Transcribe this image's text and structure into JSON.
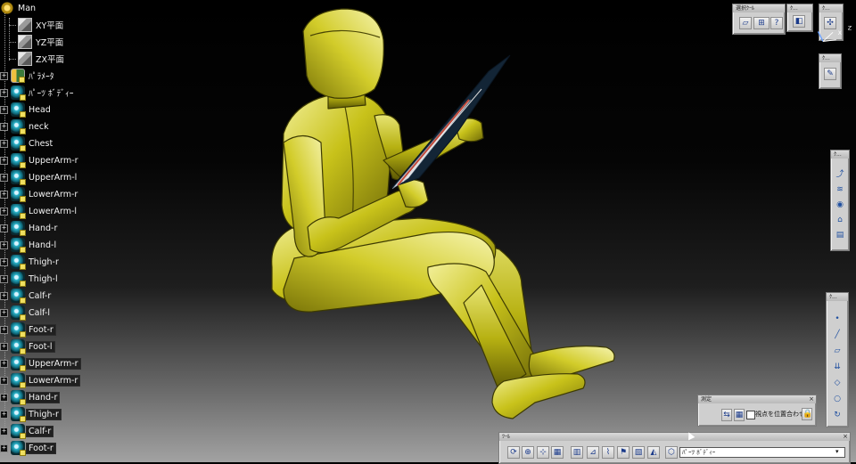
{
  "spec_tree": {
    "root": "Man",
    "planes": [
      "XY平面",
      "YZ平面",
      "ZX平面"
    ],
    "parameters": "ﾊﾟﾗﾒｰﾀ",
    "part_body": "ﾊﾟｰﾂ ﾎﾞﾃﾞｨｰ",
    "bodies": [
      "Head",
      "neck",
      "Chest",
      "UpperArm-r",
      "UpperArm-l",
      "LowerArm-r",
      "LowerArm-l",
      "Hand-r",
      "Hand-l",
      "Thigh-r",
      "Thigh-l",
      "Calf-r",
      "Calf-l",
      "Foot-r",
      "Foot-l",
      "UpperArm-r",
      "LowerArm-r",
      "Hand-r",
      "Thigh-r",
      "Calf-r",
      "Foot-r"
    ]
  },
  "toolbars": {
    "select": {
      "title": "選択ｸｰﾙ"
    },
    "small_a": {
      "title": "ｸ..."
    },
    "small_b": {
      "title": "ｸ..."
    },
    "small_c": {
      "title": "ｸ..."
    },
    "vertical_a": {
      "title": "ｸ..."
    },
    "vertical_b": {
      "title": "ｸ..."
    },
    "measure": {
      "title": "測定",
      "checkbox_label": "視点を位置合わせ"
    },
    "tools": {
      "title": "ﾂｰﾙ",
      "current_body": "ﾊﾟｰﾂ ﾎﾞﾃﾞｨｰ"
    }
  },
  "compass": {
    "axis_x": "X",
    "axis_z": "Z"
  },
  "colors": {
    "model_fill": "#c8c21a",
    "model_highlight": "#f1ef8c",
    "model_shadow": "#6f6a08",
    "document": "#162c3e",
    "background_top": "#000000",
    "background_bottom": "#a2a2a2",
    "toolbar_bg": "#cfcfcf"
  },
  "icons": [
    "spec-tree-node-icon",
    "plane-icon",
    "parameter-icon",
    "gear-icon",
    "compass-icon",
    "measure-icon",
    "lock-icon",
    "select-icon",
    "help-icon",
    "point-icon",
    "line-icon",
    "sketch-icon",
    "rotate-icon",
    "dropdown-icon"
  ]
}
